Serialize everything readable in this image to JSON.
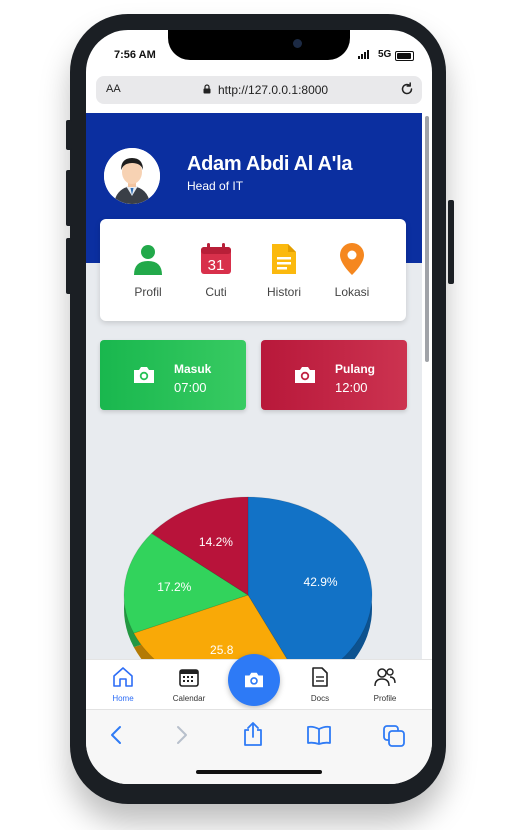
{
  "status": {
    "time": "7:56 AM",
    "network": "5G"
  },
  "browser": {
    "aa_label": "AA",
    "url": "http://127.0.0.1:8000"
  },
  "profile": {
    "name": "Adam Abdi Al A'la",
    "role": "Head of IT"
  },
  "menu": [
    {
      "label": "Profil",
      "icon": "user-icon"
    },
    {
      "label": "Cuti",
      "icon": "calendar-icon",
      "badge": "31"
    },
    {
      "label": "Histori",
      "icon": "document-icon"
    },
    {
      "label": "Lokasi",
      "icon": "location-pin-icon"
    }
  ],
  "attendance": {
    "in": {
      "label": "Masuk",
      "time": "07:00",
      "color": "#1fbf55"
    },
    "out": {
      "label": "Pulang",
      "time": "12:00",
      "color": "#c2203e"
    }
  },
  "chart_data": {
    "type": "pie",
    "slices": [
      {
        "label": "42.9%",
        "value": 42.9,
        "color": "#1272c6"
      },
      {
        "label": "25.8",
        "value": 25.8,
        "color": "#f9a907"
      },
      {
        "label": "17.2%",
        "value": 17.2,
        "color": "#32d35c"
      },
      {
        "label": "14.2%",
        "value": 14.2,
        "color": "#b8133a"
      }
    ]
  },
  "bottom_nav": {
    "home": "Home",
    "calendar": "Calendar",
    "docs": "Docs",
    "profile": "Profile"
  },
  "colors": {
    "header": "#0b2fa0",
    "accent": "#2d7af6"
  }
}
